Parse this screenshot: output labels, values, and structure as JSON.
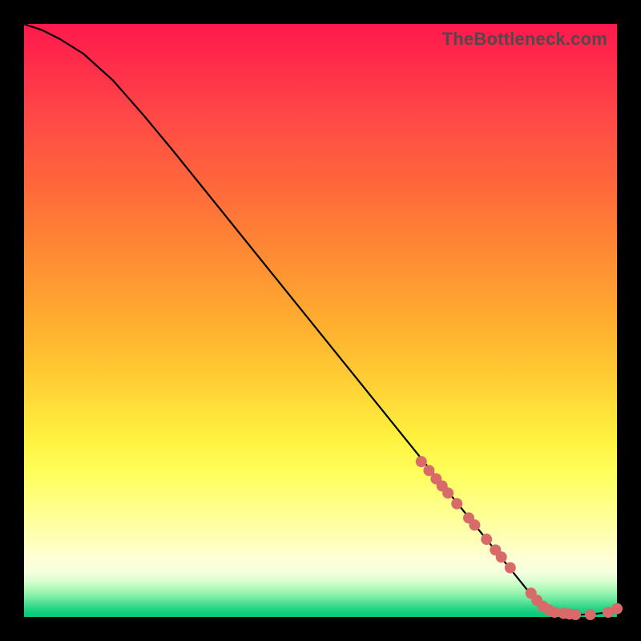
{
  "watermark": "TheBottleneck.com",
  "chart_data": {
    "type": "line",
    "title": "",
    "xlabel": "",
    "ylabel": "",
    "xlim": [
      0,
      100
    ],
    "ylim": [
      0,
      100
    ],
    "grid": false,
    "series": [
      {
        "name": "curve",
        "x": [
          0,
          3,
          6,
          10,
          15,
          20,
          25,
          30,
          35,
          40,
          45,
          50,
          55,
          60,
          65,
          70,
          75,
          80,
          85,
          88,
          90,
          92,
          94,
          96,
          98,
          100
        ],
        "y": [
          100,
          99,
          97.5,
          95,
          90.5,
          84.8,
          78.8,
          72.6,
          66.4,
          60.2,
          54.0,
          47.8,
          41.6,
          35.4,
          29.2,
          23.0,
          16.8,
          10.6,
          4.4,
          1.4,
          0.6,
          0.4,
          0.4,
          0.5,
          0.7,
          1.4
        ]
      }
    ],
    "markers": {
      "name": "highlight-points",
      "x": [
        67,
        68.3,
        69.5,
        70.5,
        71.5,
        73,
        75,
        76,
        78,
        79.5,
        80.5,
        82,
        85.5,
        86.5,
        87.5,
        88.5,
        89.5,
        91,
        92,
        93,
        95.5,
        98.5,
        100
      ],
      "y": [
        26.2,
        24.7,
        23.3,
        22.1,
        20.9,
        19.1,
        16.7,
        15.5,
        13.1,
        11.3,
        10.1,
        8.3,
        4.0,
        2.8,
        1.8,
        1.2,
        0.8,
        0.6,
        0.5,
        0.4,
        0.4,
        0.8,
        1.4
      ]
    },
    "background_gradient": {
      "direction": "vertical",
      "stops": [
        {
          "pos": 0.0,
          "color": "#ff1a4d"
        },
        {
          "pos": 0.4,
          "color": "#ff8e33"
        },
        {
          "pos": 0.7,
          "color": "#fff23f"
        },
        {
          "pos": 0.9,
          "color": "#ffffd6"
        },
        {
          "pos": 1.0,
          "color": "#05c877"
        }
      ]
    }
  }
}
